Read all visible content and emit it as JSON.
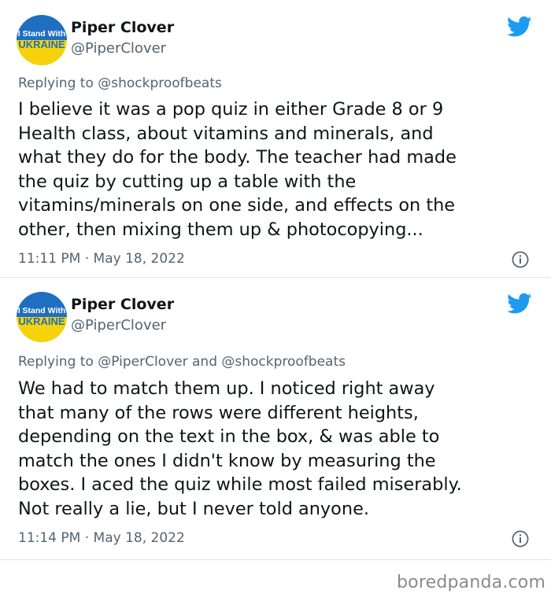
{
  "colors": {
    "text_primary": "#0f1419",
    "text_secondary": "#536471",
    "twitter_blue": "#1d9bf0",
    "ukraine_blue": "#1f6fc0",
    "ukraine_yellow": "#f5d20a",
    "divider": "#dfe3e6"
  },
  "tweets": [
    {
      "author": {
        "display_name": "Piper Clover",
        "handle": "@PiperClover",
        "avatar_text_top": "I Stand With",
        "avatar_text_bottom": "UKRAINE"
      },
      "replying_prefix": "Replying to",
      "replying_to": "@shockproofbeats",
      "text_lines": [
        "I believe it was a pop quiz in either Grade 8 or 9",
        "Health class, about vitamins and minerals, and",
        "what they do for the body. The teacher had made",
        "the quiz by cutting up a table with the",
        "vitamins/minerals on one side, and effects on the",
        "other, then mixing them up & photocopying..."
      ],
      "timestamp": "11:11 PM · May 18, 2022",
      "icons": [
        "twitter-bird-icon",
        "info-icon"
      ]
    },
    {
      "author": {
        "display_name": "Piper Clover",
        "handle": "@PiperClover",
        "avatar_text_top": "I Stand With",
        "avatar_text_bottom": "UKRAINE"
      },
      "replying_prefix": "Replying to",
      "replying_to": "@PiperClover",
      "replying_joiner": "and",
      "replying_to_2": "@shockproofbeats",
      "text_lines": [
        "We had to match them up. I noticed right away",
        "that many of the rows were different heights,",
        "depending on the text in the box, & was able to",
        "match the ones I didn't know by measuring the",
        "boxes. I aced the quiz while most failed miserably.",
        "Not really a lie, but I never told anyone."
      ],
      "timestamp": "11:14 PM · May 18, 2022",
      "icons": [
        "twitter-bird-icon",
        "info-icon"
      ]
    }
  ],
  "watermark": "boredpanda.com"
}
